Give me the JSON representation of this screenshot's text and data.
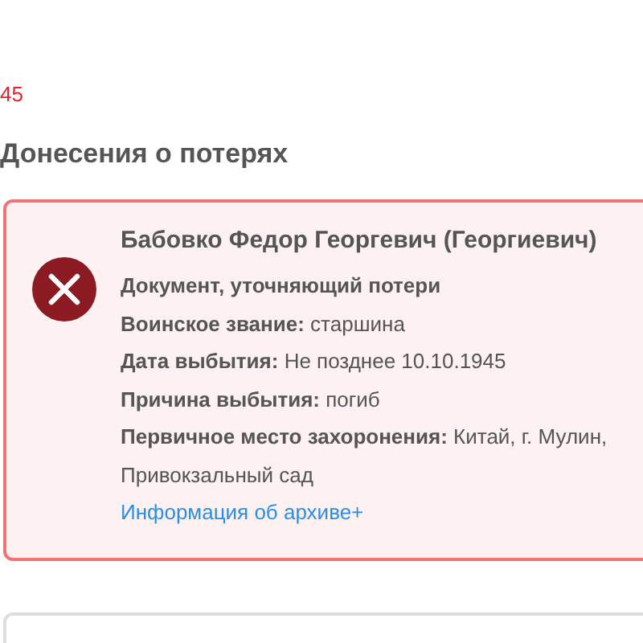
{
  "year_fragment": "45",
  "section_title": "Донесения о потерях",
  "record": {
    "name": "Бабовко Федор Георгевич (Георгиевич)",
    "document": "Документ, уточняющий потери",
    "fields": [
      "**Воинское звание:** старшина",
      "**Дата выбытия:** Не позднее 10.10.1945",
      "**Причина выбытия:** погиб",
      "**Первичное место захоронения:** Китай, г. Мулин, Привокзальный сад"
    ],
    "link": "Информация об архиве+"
  }
}
